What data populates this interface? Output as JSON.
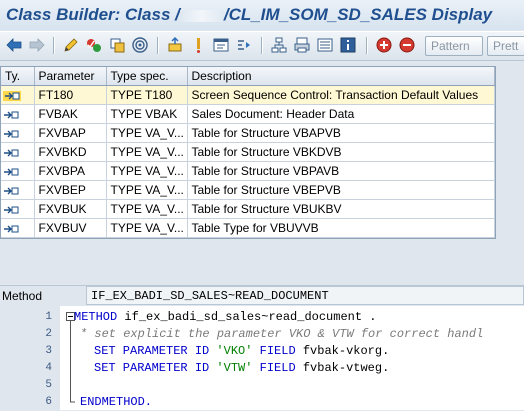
{
  "window": {
    "title_prefix": "Class Builder: Class /",
    "title_suffix": "/CL_IM_SOM_SD_SALES Display"
  },
  "toolbar": {
    "icons": [
      "back-arrow-icon",
      "forward-arrow-icon",
      "edit-pencil-icon",
      "check-icon",
      "activate-icon",
      "test-icon",
      "where-used-icon",
      "object-list-icon",
      "navigation-window-icon",
      "display-object-list-icon",
      "hierarchy-icon",
      "print-icon",
      "info-icon",
      "insert-breakpoint-icon",
      "session-breakpoint-icon"
    ],
    "pattern_label": "Pattern",
    "pretty_label": "Prett"
  },
  "params_table": {
    "headers": [
      "Ty.",
      "Parameter",
      "Type spec.",
      "Description"
    ],
    "rows": [
      {
        "param": "FT180",
        "type": "TYPE T180",
        "desc": "Screen Sequence Control: Transaction Default Values"
      },
      {
        "param": "FVBAK",
        "type": "TYPE VBAK",
        "desc": "Sales Document: Header Data"
      },
      {
        "param": "FXVBAP",
        "type": "TYPE VA_V...",
        "desc": "Table for Structure VBAPVB"
      },
      {
        "param": "FXVBKD",
        "type": "TYPE VA_V...",
        "desc": "Table for Structure VBKDVB"
      },
      {
        "param": "FXVBPA",
        "type": "TYPE VA_V...",
        "desc": "Table for Structure VBPAVB"
      },
      {
        "param": "FXVBEP",
        "type": "TYPE VA_V...",
        "desc": "Table for Structure VBEPVB"
      },
      {
        "param": "FXVBUK",
        "type": "TYPE VA_V...",
        "desc": "Table for Structure VBUKBV"
      },
      {
        "param": "FXVBUV",
        "type": "TYPE VA_V...",
        "desc": "Table Type for VBUVVB"
      }
    ]
  },
  "method": {
    "label": "Method",
    "value": "IF_EX_BADI_SD_SALES~READ_DOCUMENT"
  },
  "code": {
    "line_numbers": [
      "1",
      "2",
      "3",
      "4",
      "5",
      "6"
    ],
    "line1_kw": "METHOD",
    "line1_rest": " if_ex_badi_sd_sales~read_document .",
    "line2": "* set explicit the parameter VKO & VTW for correct handl",
    "line3_a": "SET PARAMETER ID ",
    "line3_str": "'VKO'",
    "line3_b": " FIELD ",
    "line3_c": "fvbak-vkorg.",
    "line4_a": "SET PARAMETER ID ",
    "line4_str": "'VTW'",
    "line4_b": " FIELD ",
    "line4_c": "fvbak-vtweg.",
    "line6_kw": "ENDMETHOD."
  }
}
